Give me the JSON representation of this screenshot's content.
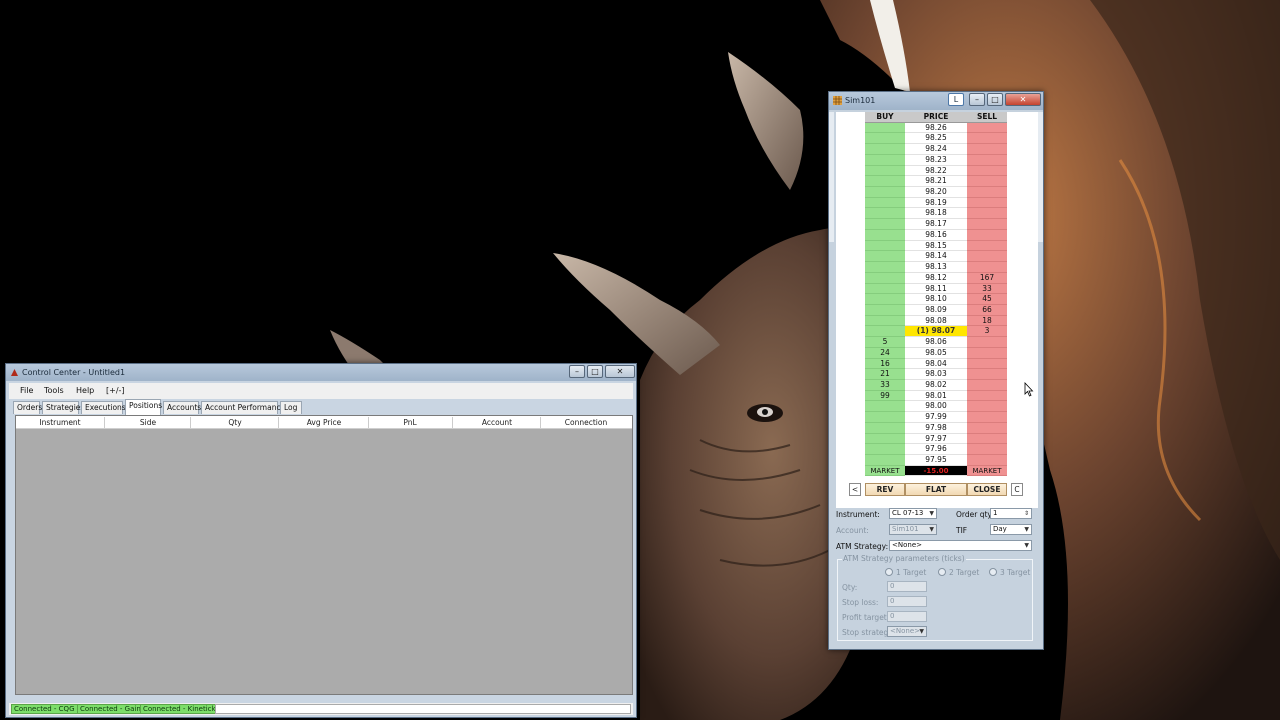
{
  "colors": {
    "buy_column": "#98e08f",
    "sell_column": "#ef9191",
    "last_price_highlight": "#ffe600",
    "pnl_text": "#e02020",
    "connection_ok": "#7dde6a"
  },
  "control_center": {
    "title": "Control Center - Untitled1",
    "menu": [
      "File",
      "Tools",
      "Help",
      "[+/-]"
    ],
    "tabs": [
      "Orders",
      "Strategies",
      "Executions",
      "Positions",
      "Accounts",
      "Account Performance",
      "Log"
    ],
    "active_tab": "Positions",
    "columns": [
      "Instrument",
      "Side",
      "Qty",
      "Avg Price",
      "PnL",
      "Account",
      "Connection"
    ],
    "connections": [
      "Connected - CQG",
      "Connected - Gain",
      "Connected - Kinetick"
    ]
  },
  "superdom": {
    "title": "Sim101",
    "link_button": "L",
    "headers": {
      "buy": "BUY",
      "price": "PRICE",
      "sell": "SELL"
    },
    "rows": [
      {
        "buy": "",
        "price": "98.26",
        "sell": ""
      },
      {
        "buy": "",
        "price": "98.25",
        "sell": ""
      },
      {
        "buy": "",
        "price": "98.24",
        "sell": ""
      },
      {
        "buy": "",
        "price": "98.23",
        "sell": ""
      },
      {
        "buy": "",
        "price": "98.22",
        "sell": ""
      },
      {
        "buy": "",
        "price": "98.21",
        "sell": ""
      },
      {
        "buy": "",
        "price": "98.20",
        "sell": ""
      },
      {
        "buy": "",
        "price": "98.19",
        "sell": ""
      },
      {
        "buy": "",
        "price": "98.18",
        "sell": ""
      },
      {
        "buy": "",
        "price": "98.17",
        "sell": ""
      },
      {
        "buy": "",
        "price": "98.16",
        "sell": ""
      },
      {
        "buy": "",
        "price": "98.15",
        "sell": ""
      },
      {
        "buy": "",
        "price": "98.14",
        "sell": ""
      },
      {
        "buy": "",
        "price": "98.13",
        "sell": ""
      },
      {
        "buy": "",
        "price": "98.12",
        "sell": "167"
      },
      {
        "buy": "",
        "price": "98.11",
        "sell": "33"
      },
      {
        "buy": "",
        "price": "98.10",
        "sell": "45"
      },
      {
        "buy": "",
        "price": "98.09",
        "sell": "66"
      },
      {
        "buy": "",
        "price": "98.08",
        "sell": "18"
      },
      {
        "buy": "",
        "price": "(1) 98.07",
        "sell": "3",
        "last": true
      },
      {
        "buy": "5",
        "price": "98.06",
        "sell": ""
      },
      {
        "buy": "24",
        "price": "98.05",
        "sell": ""
      },
      {
        "buy": "16",
        "price": "98.04",
        "sell": ""
      },
      {
        "buy": "21",
        "price": "98.03",
        "sell": ""
      },
      {
        "buy": "33",
        "price": "98.02",
        "sell": ""
      },
      {
        "buy": "99",
        "price": "98.01",
        "sell": ""
      },
      {
        "buy": "",
        "price": "98.00",
        "sell": ""
      },
      {
        "buy": "",
        "price": "97.99",
        "sell": ""
      },
      {
        "buy": "",
        "price": "97.98",
        "sell": ""
      },
      {
        "buy": "",
        "price": "97.97",
        "sell": ""
      },
      {
        "buy": "",
        "price": "97.96",
        "sell": ""
      },
      {
        "buy": "",
        "price": "97.95",
        "sell": ""
      }
    ],
    "market_row": {
      "buy": "MARKET",
      "pnl": "-15.00",
      "sell": "MARKET"
    },
    "buttons": {
      "left": "<",
      "rev": "REV",
      "flat": "FLAT",
      "close": "CLOSE",
      "right": "C"
    },
    "instrument_label": "Instrument:",
    "instrument_value": "CL 07-13",
    "order_qty_label": "Order qty",
    "order_qty_value": "1",
    "account_label": "Account:",
    "account_value": "Sim101",
    "tif_label": "TIF",
    "tif_value": "Day",
    "atm_label": "ATM Strategy:",
    "atm_value": "<None>",
    "atm_group_title": "ATM Strategy parameters (ticks)",
    "targets": [
      "1 Target",
      "2 Target",
      "3 Target"
    ],
    "qty_label": "Qty:",
    "qty_value": "0",
    "stop_loss_label": "Stop loss:",
    "stop_loss_value": "0",
    "profit_target_label": "Profit target:",
    "profit_target_value": "0",
    "stop_strategy_label": "Stop strategy:",
    "stop_strategy_value": "<None>"
  }
}
